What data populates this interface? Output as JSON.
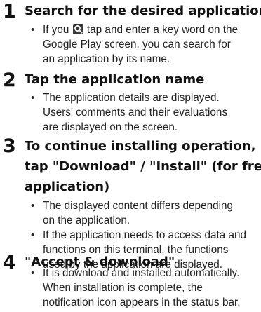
{
  "steps": [
    {
      "number": "1",
      "title": [
        "Search for the desired application"
      ],
      "bullets": [
        {
          "lines": [
            {
              "before": "If you ",
              "icon": "search-icon",
              "after": " tap and enter a key word on the"
            },
            {
              "text": "Google Play screen, you can search for"
            },
            {
              "text": "an application by its name."
            }
          ]
        }
      ]
    },
    {
      "number": "2",
      "title": [
        "Tap the application name"
      ],
      "bullets": [
        {
          "lines": [
            {
              "text": "The application details are displayed."
            },
            {
              "text": "Users' comments and their evaluations"
            },
            {
              "text": "are displayed on the screen."
            }
          ]
        }
      ]
    },
    {
      "number": "3",
      "title": [
        "To continue installing operation,",
        "tap \"Download\" / \"Install\" (for free",
        "application)"
      ],
      "bullets": [
        {
          "lines": [
            {
              "text": "The displayed content differs depending"
            },
            {
              "text": "on the application."
            }
          ]
        },
        {
          "lines": [
            {
              "text": "If the application needs to access data and"
            },
            {
              "text": "functions on this terminal, the functions"
            },
            {
              "text": "used by the application are displayed."
            }
          ]
        }
      ]
    },
    {
      "number": "4",
      "title": [
        "\"Accept & download\""
      ],
      "bullets": [
        {
          "lines": [
            {
              "text": "It is download and installed automatically."
            },
            {
              "text": "When installation is complete, the"
            },
            {
              "text": "notification icon appears in the status bar."
            }
          ]
        }
      ]
    }
  ],
  "bullet_glyph": "•",
  "colors": {
    "text": "#222222",
    "heading": "#111111",
    "icon_bg": "#3a3a3a"
  }
}
